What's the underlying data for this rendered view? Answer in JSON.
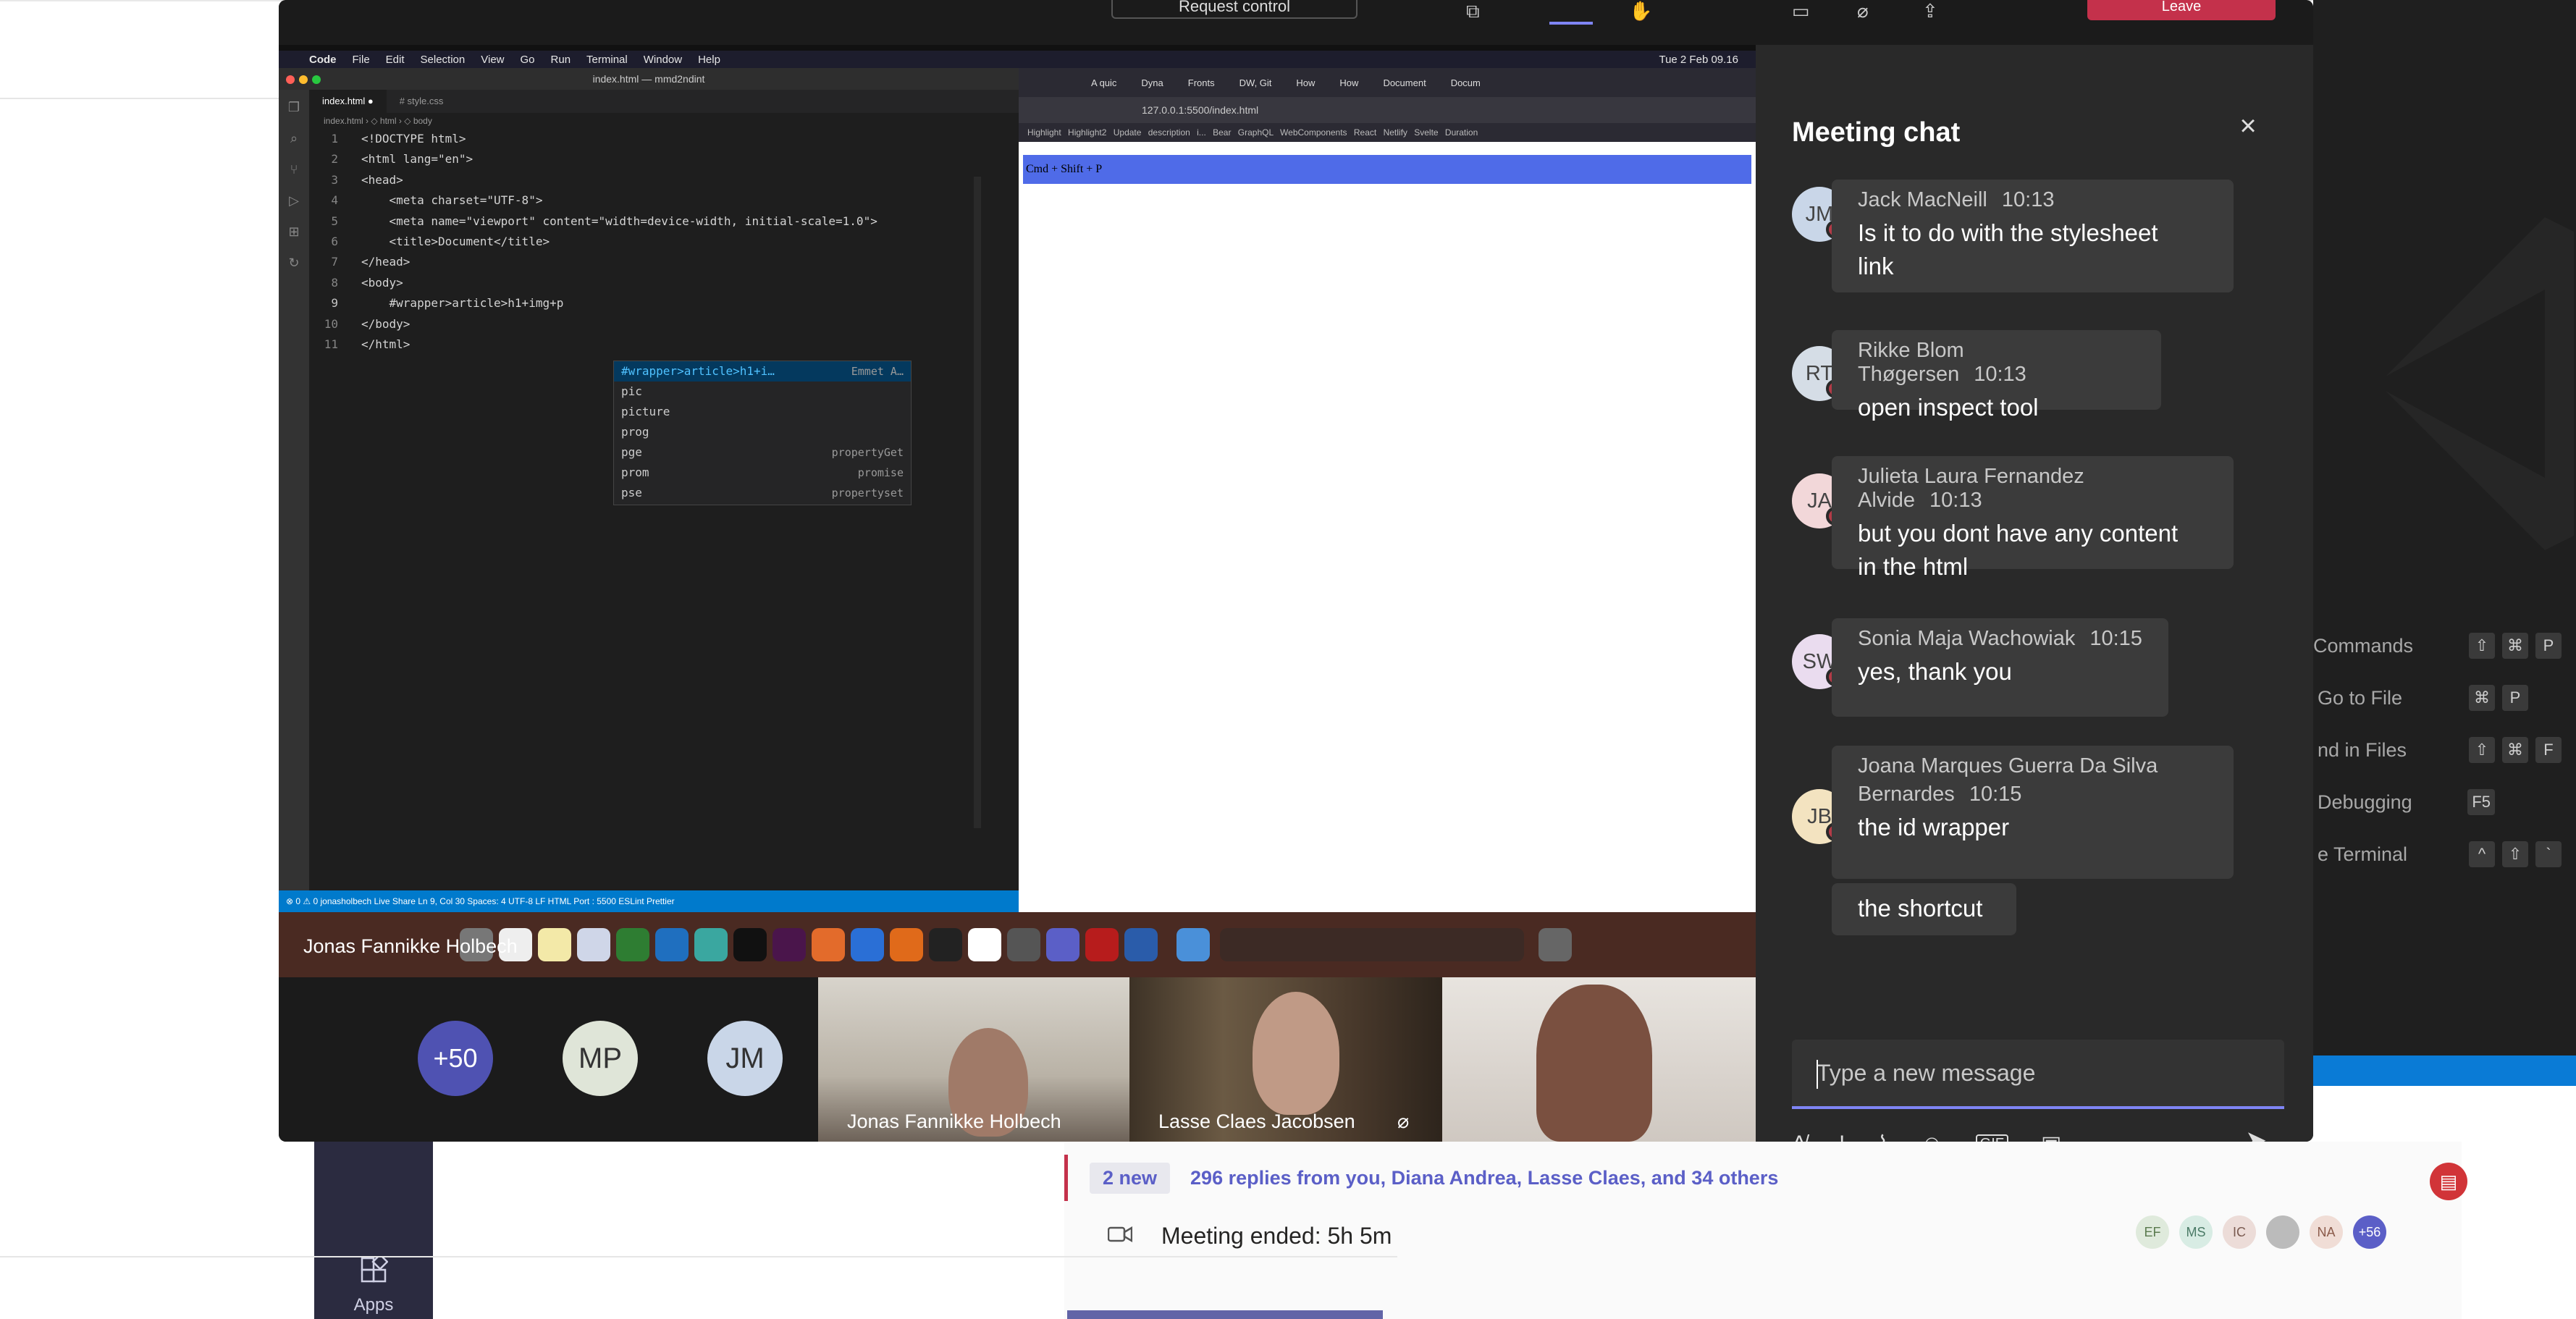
{
  "teams": {
    "apps_label": "Apps",
    "feed": {
      "new_badge": "2 new",
      "replies_text": "296 replies from you, Diana Andrea, Lasse Claes, and 34 others",
      "meeting_ended": "Meeting ended: 5h 5m",
      "participant_initials": [
        "EF",
        "MS",
        "IC",
        "",
        "NA",
        "+56"
      ]
    }
  },
  "meeting": {
    "request_control_label": "Request control",
    "leave_label": "Leave",
    "presenter_name": "Jonas Fannikke Holbech",
    "gallery": {
      "overflow_count": "+50",
      "avatars": [
        "MP",
        "JM"
      ],
      "videos": [
        {
          "name": "Jonas Fannikke Holbech"
        },
        {
          "name": "Lasse Claes Jacobsen"
        },
        {
          "name": ""
        }
      ]
    }
  },
  "shared_screen": {
    "menubar": {
      "app": "Code",
      "items": [
        "File",
        "Edit",
        "Selection",
        "View",
        "Go",
        "Run",
        "Terminal",
        "Window",
        "Help"
      ],
      "clock": "Tue 2 Feb 09.16"
    },
    "vscode": {
      "window_title": "index.html — mmd2ndint",
      "tabs": [
        "index.html ●",
        "# style.css"
      ],
      "breadcrumb": "index.html › ◇ html › ◇ body",
      "lines": [
        "<!DOCTYPE html>",
        "<html lang=\"en\">",
        "<head>",
        "    <meta charset=\"UTF-8\">",
        "    <meta name=\"viewport\" content=\"width=device-width, initial-scale=1.0\">",
        "    <title>Document</title>",
        "</head>",
        "<body>",
        "    #wrapper>article>h1+img+p",
        "</body>",
        "</html>"
      ],
      "suggestions": [
        {
          "text": "#wrapper>article>h1+i…",
          "detail": "Emmet A…"
        },
        {
          "text": "pic",
          "detail": ""
        },
        {
          "text": "picture",
          "detail": ""
        },
        {
          "text": "prog",
          "detail": ""
        },
        {
          "text": "pge",
          "detail": "propertyGet"
        },
        {
          "text": "prom",
          "detail": "promise"
        },
        {
          "text": "pse",
          "detail": "propertyset"
        }
      ],
      "status_bar": "⊗ 0 ⚠ 0   jonasholbech   Live Share          Ln 9, Col 30   Spaces: 4   UTF-8   LF   HTML   Port : 5500   ESLint   Prettier"
    },
    "browser": {
      "tabs": [
        "A quic",
        "Dyna",
        "Fronts",
        "DW, Git",
        "How",
        "How",
        "Document",
        "Docum"
      ],
      "url": "127.0.0.1:5500/index.html",
      "bookmarks": "Highlight   Highlight2   Update description i...   Bear   GraphQL   WebComponents   React   Netlify   Svelte   Duration",
      "page_text": "Cmd + Shift + P"
    }
  },
  "chat": {
    "title": "Meeting chat",
    "messages": [
      {
        "initials": "JM",
        "avatar_color": "#c9d6e8",
        "author": "Jack MacNeill",
        "time": "10:13",
        "lines": [
          "Is it to do with the stylesheet",
          "link"
        ]
      },
      {
        "initials": "RT",
        "avatar_color": "#d5dde6",
        "author": "Rikke Blom Thøgersen",
        "time": "10:13",
        "lines": [
          "open inspect tool"
        ]
      },
      {
        "initials": "JA",
        "avatar_color": "#f2d7d9",
        "author": "Julieta Laura Fernandez Alvide",
        "time": "10:13",
        "lines": [
          "but you dont have any content",
          "in the html"
        ]
      },
      {
        "initials": "SW",
        "avatar_color": "#eadcef",
        "author": "Sonia Maja Wachowiak",
        "time": "10:15",
        "lines": [
          "yes, thank you"
        ]
      },
      {
        "initials": "JB",
        "avatar_color": "#f3e3c0",
        "author": "Joana Marques Guerra Da Silva",
        "author2": "Bernardes",
        "time": "10:15",
        "lines": [
          "the id wrapper"
        ]
      },
      {
        "lines": [
          "the shortcut"
        ]
      }
    ],
    "compose_placeholder": "Type a new message"
  },
  "vscode_background": {
    "commands": [
      {
        "label": "Commands",
        "keys": [
          "⇧",
          "⌘",
          "P"
        ]
      },
      {
        "label": "Go to File",
        "keys": [
          "⌘",
          "P"
        ]
      },
      {
        "label": "nd in Files",
        "keys": [
          "⇧",
          "⌘",
          "F"
        ]
      },
      {
        "label": "Debugging",
        "keys": [
          "F5"
        ]
      },
      {
        "label": "e Terminal",
        "keys": [
          "^",
          "⇧",
          "`"
        ]
      }
    ]
  },
  "colors": {
    "teams_purple": "#5b5fc7",
    "leave_red": "#c4314b",
    "vscode_blue": "#007acc",
    "chat_bg": "#292929"
  }
}
